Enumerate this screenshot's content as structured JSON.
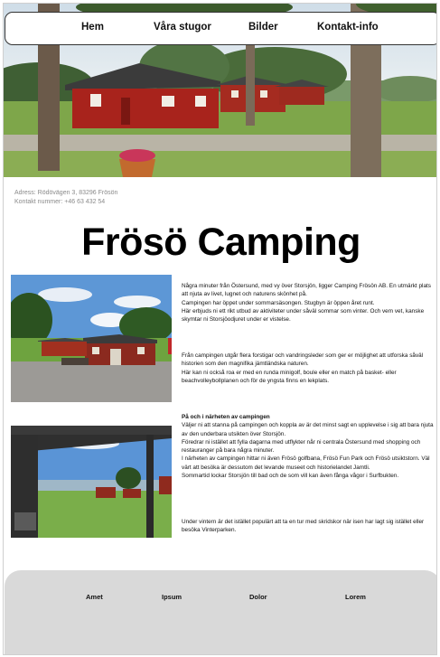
{
  "nav": {
    "items": [
      {
        "label": "Hem"
      },
      {
        "label": "Våra stugor"
      },
      {
        "label": "Bilder"
      },
      {
        "label": "Kontakt-info"
      }
    ]
  },
  "address": {
    "line1": "Adress: Rödövägen 3, 83296 Frösön",
    "line2": "Kontakt nummer: +46 63 432 54"
  },
  "title": "Frösö Camping",
  "section1": {
    "p1": "Några minuter från Östersund, med vy över Storsjön, ligger Camping Frösön AB. En utmärkt plats att njuta av livet, lugnet och naturens skönhet på.",
    "p2": "Campingen har öppet under sommarsäsongen. Stugbyn är öppen året runt.",
    "p3": "Här erbjuds ni ett rikt utbud av aktiviteter under såväl sommar som vinter. Och vem vet, kanske skymtar ni Storsjöodjuret under er vistelse."
  },
  "section2": {
    "p1": "Från campingen utgår flera forstigar och vandringsleder som ger er möjlighet att utforska såväl historien som den magnifika jämtländska naturen.",
    "p2": "Här kan ni också roa er med en runda minigolf, boule eller en match på basket- eller beachvolleybollplanen och för de yngsta finns en lekplats."
  },
  "section3": {
    "heading": "På och i närheten av campingen",
    "p1": "Väljer ni att stanna på campingen och koppla av är det minst sagt en upplevelse i sig att bara njuta av den underbara utsikten över Storsjön.",
    "p2": "Föredrar ni istället att fylla dagarna med utflykter når ni centrala Östersund med shopping och restauranger på bara några minuter.",
    "p3": "I närheten av campingen hittar ni även Frösö golfbana, Frösö Fun Park och Frösö utsiktstorn. Väl värt att besöka är dessutom det levande museet och historielandet Jamtli.",
    "p4": "Sommartid lockar Storsjön till bad och de som vill kan även fånga vågor i Surfbukten."
  },
  "section4": {
    "p1": "Under vintern är det istället populärt att ta en tur med skridskor när isen har lagt sig istället eller besöka Vinterparken."
  },
  "footer": {
    "items": [
      {
        "label": "Amet"
      },
      {
        "label": "Ipsum"
      },
      {
        "label": "Dolor"
      },
      {
        "label": "Lorem"
      }
    ]
  },
  "colors": {
    "cabin_red": "#a8231c",
    "grass": "#6f9a3a",
    "footer_bg": "#d9d9d9",
    "sky": "#dfe9f2"
  }
}
